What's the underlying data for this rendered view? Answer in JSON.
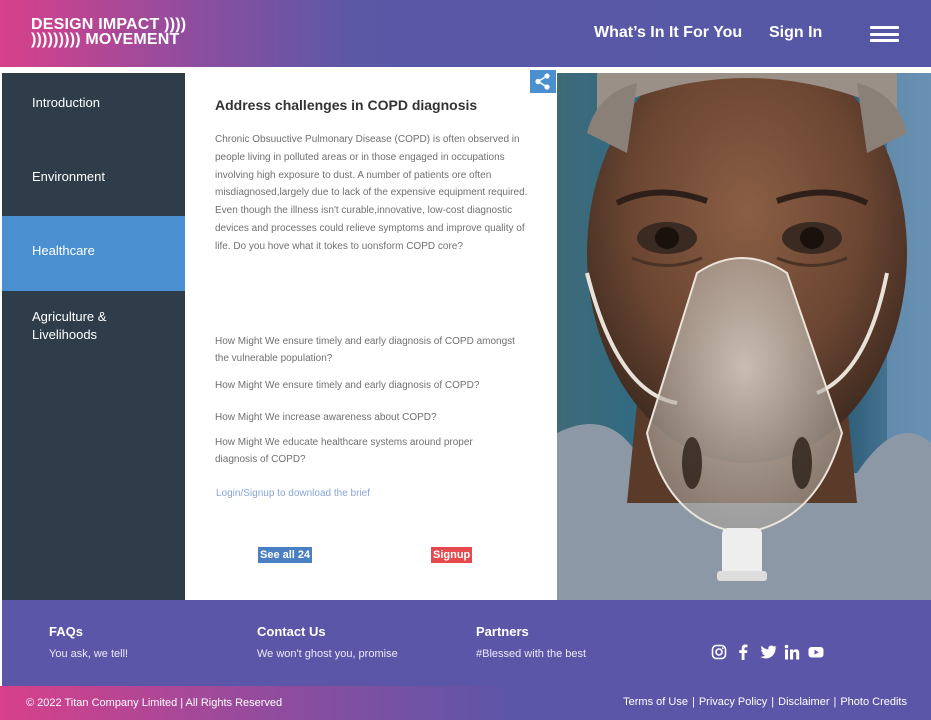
{
  "header": {
    "logo_line1": "DESIGN IMPACT ))))",
    "logo_line2": "))))))))) MOVEMENT",
    "nav_whats": "What’s In It For You",
    "nav_signin": "Sign In",
    "menu_icon": "hamburger-menu-icon"
  },
  "sidebar": {
    "items": [
      {
        "label": "Introduction",
        "active": false
      },
      {
        "label": "Environment",
        "active": false
      },
      {
        "label": "Healthcare",
        "active": true
      },
      {
        "label": "Agriculture & Livelihoods",
        "active": false
      }
    ],
    "agri_line1": "Agriculture &",
    "agri_line2": "Livelihoods",
    "active_color": "#4a90d0"
  },
  "content": {
    "title": "Address  challenges in COPD diagnosis",
    "body": "Chronic Obsuuctive Pulmonary Disease (COPD) is often observed in people living in polluted areas or in those engaged in occupations involving high exposure to dust. A number of patients ore often misdiagnosed,largely due to lack of the expensive equipment required. Even though the illness isn't curable,innovative, low-cost diagnostic devices and processes could relieve symptoms and improve quality of life. Do you hove what it tokes to uonsform COPD core?",
    "hmw": [
      "How Might We ensure timely and early diagnosis of COPD amongst the vulnerable population?",
      "How Might We ensure timely and early diagnosis of COPD?",
      "How Might We increase awareness about  COPD?",
      "How Might We educate healthcare systems around proper diagnosis of COPD?"
    ],
    "login_link": "Login/Signup to download the brief",
    "see_all": "See all 24",
    "signup": "Signup",
    "share_icon": "share-icon"
  },
  "footer": {
    "faq_title": "FAQs",
    "faq_sub": "You ask, we tell!",
    "contact_title": "Contact Us",
    "contact_sub": "We won't ghost you, promise",
    "partners_title": "Partners",
    "partners_sub": "#Blessed with the best",
    "socials": [
      "instagram-icon",
      "facebook-icon",
      "twitter-icon",
      "linkedin-icon",
      "youtube-icon"
    ]
  },
  "bottom": {
    "copyright": "© 2022 Titan Company Limited | All Rights Reserved",
    "links": [
      "Terms of Use",
      "Privacy Policy",
      "Disclaimer",
      "Photo Credits"
    ]
  },
  "colors": {
    "brand_pink": "#d8408a",
    "brand_purple": "#5457a5",
    "sidebar_bg": "#2f3d4a",
    "accent_blue": "#4a90d0",
    "signup_red": "#e5484d"
  }
}
